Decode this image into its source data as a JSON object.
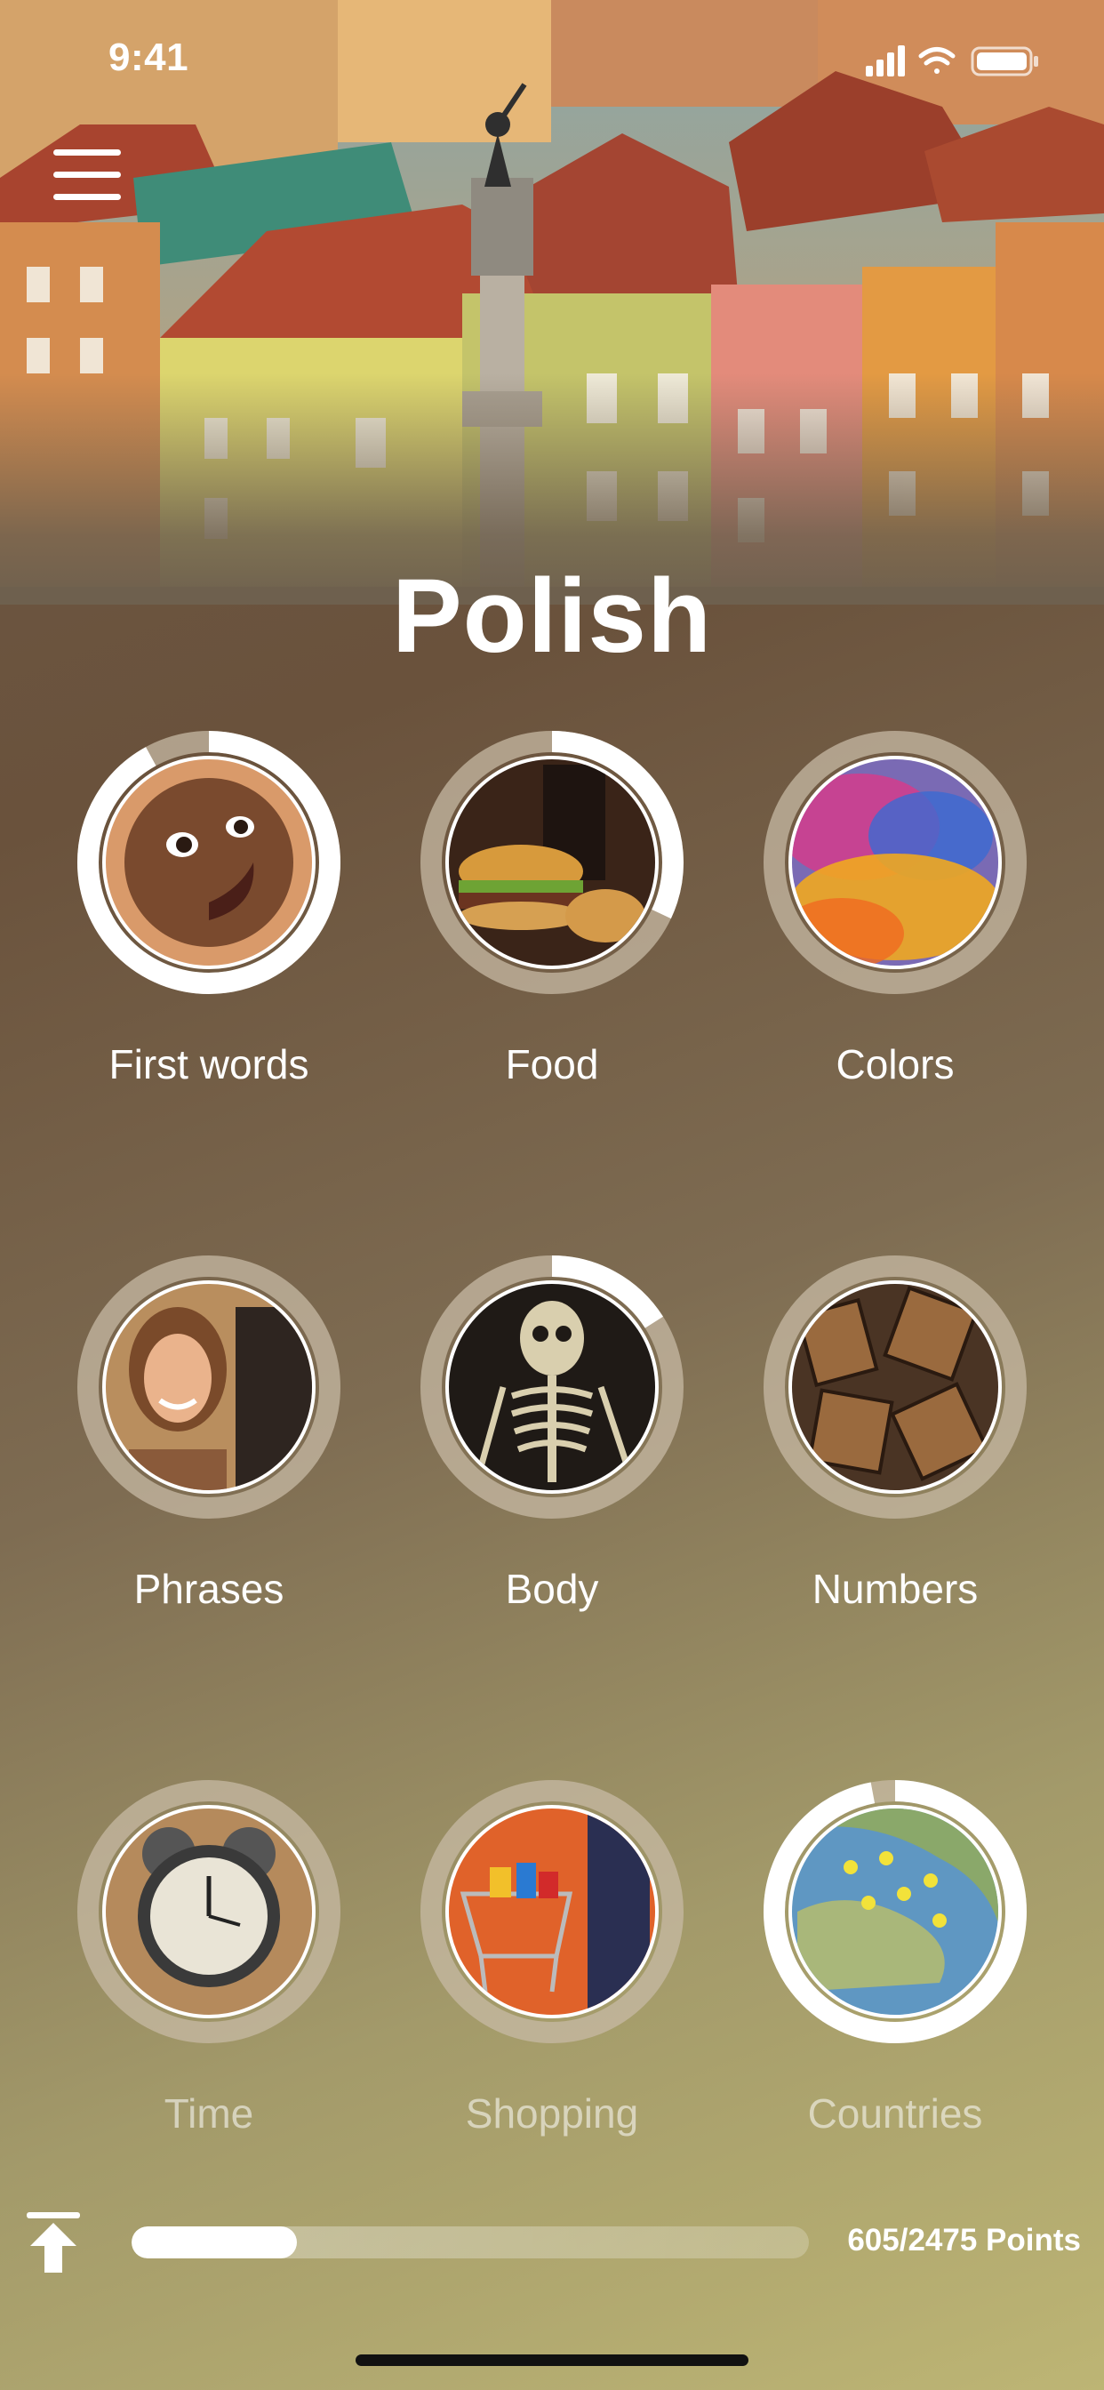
{
  "status_bar": {
    "time": "9:41"
  },
  "header": {
    "title": "Polish"
  },
  "topics": [
    {
      "label": "First words",
      "progress": 0.92,
      "theme": "baby-face",
      "dimmed": false
    },
    {
      "label": "Food",
      "progress": 0.32,
      "theme": "burger-fries",
      "dimmed": false
    },
    {
      "label": "Colors",
      "progress": 0.0,
      "theme": "color-powder",
      "dimmed": false
    },
    {
      "label": "Phrases",
      "progress": 0.0,
      "theme": "couple-talking",
      "dimmed": false
    },
    {
      "label": "Body",
      "progress": 0.16,
      "theme": "skeleton",
      "dimmed": false
    },
    {
      "label": "Numbers",
      "progress": 0.0,
      "theme": "wooden-numbers",
      "dimmed": false
    },
    {
      "label": "Time",
      "progress": 0.0,
      "theme": "alarm-clock",
      "dimmed": true
    },
    {
      "label": "Shopping",
      "progress": 0.0,
      "theme": "shopping-cart",
      "dimmed": true
    },
    {
      "label": "Countries",
      "progress": 0.97,
      "theme": "map-pins",
      "dimmed": true
    }
  ],
  "footer": {
    "points_text": "605/2475 Points",
    "points_earned": 605,
    "points_total": 2475
  },
  "colors": {
    "ring_track": "#c7b9a4",
    "ring_progress": "#ffffff"
  }
}
